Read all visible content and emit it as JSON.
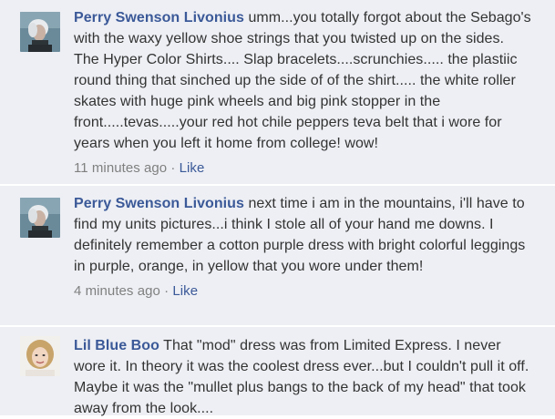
{
  "comments": [
    {
      "author": "Perry Swenson Livonius",
      "text": "umm...you totally forgot about the Sebago's with the waxy yellow shoe strings that you twisted up on the sides. The Hyper Color Shirts.... Slap bracelets....scrunchies..... the plastiic round thing that sinched up the side of of the shirt..... the white roller skates with huge pink wheels and big pink stopper in the front.....tevas.....your red hot chile peppers teva belt that i wore for years when you left it home from college! wow!",
      "timestamp": "11 minutes ago",
      "separator": "·",
      "like_label": "Like",
      "avatar_icon": "profile-photo-gray-hair"
    },
    {
      "author": "Perry Swenson Livonius",
      "text": "next time i am in the mountains, i'll have to find my units pictures...i think I stole all of your hand me downs. I definitely remember a cotton purple dress with bright colorful leggings in purple, orange, in yellow that you wore under them!",
      "timestamp": "4 minutes ago",
      "separator": "·",
      "like_label": "Like",
      "avatar_icon": "profile-photo-gray-hair"
    },
    {
      "author": "Lil Blue Boo",
      "text": "That \"mod\" dress was from Limited Express. I never wore it. In theory it was the coolest dress ever...but I couldn't pull it off. Maybe it was the \"mullet plus bangs to the back of my head\" that took away from the look....",
      "avatar_icon": "profile-photo-blonde-hair"
    }
  ],
  "colors": {
    "background": "#edeff4",
    "link": "#3b5998",
    "text": "#333333",
    "meta": "#808080"
  }
}
